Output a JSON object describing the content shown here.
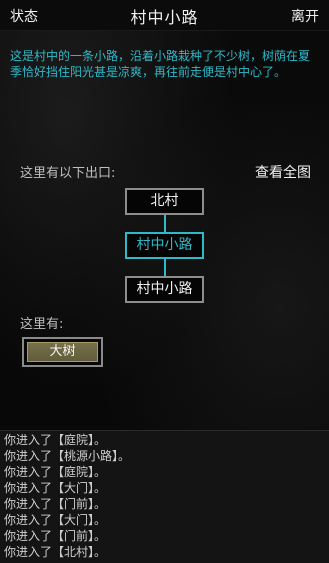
{
  "topbar": {
    "left": "状态",
    "title": "村中小路",
    "right": "离开"
  },
  "description": "这是村中的一条小路，沿着小路栽种了不少树，树荫在夏季恰好挡住阳光甚是凉爽，再往前走便是村中心了。",
  "exits": {
    "header": "这里有以下出口:",
    "fullmap": "查看全图",
    "north": "北村",
    "current": "村中小路",
    "south": "村中小路"
  },
  "here": {
    "label": "这里有:",
    "items": [
      "大树"
    ]
  },
  "log": [
    "你进入了【庭院】。",
    "你进入了【桃源小路】。",
    "你进入了【庭院】。",
    "你进入了【大门】。",
    "你进入了【门前】。",
    "你进入了【大门】。",
    "你进入了【门前】。",
    "你进入了【北村】。"
  ],
  "colors": {
    "accent": "#2fb9c9",
    "item": "#6b6543"
  }
}
